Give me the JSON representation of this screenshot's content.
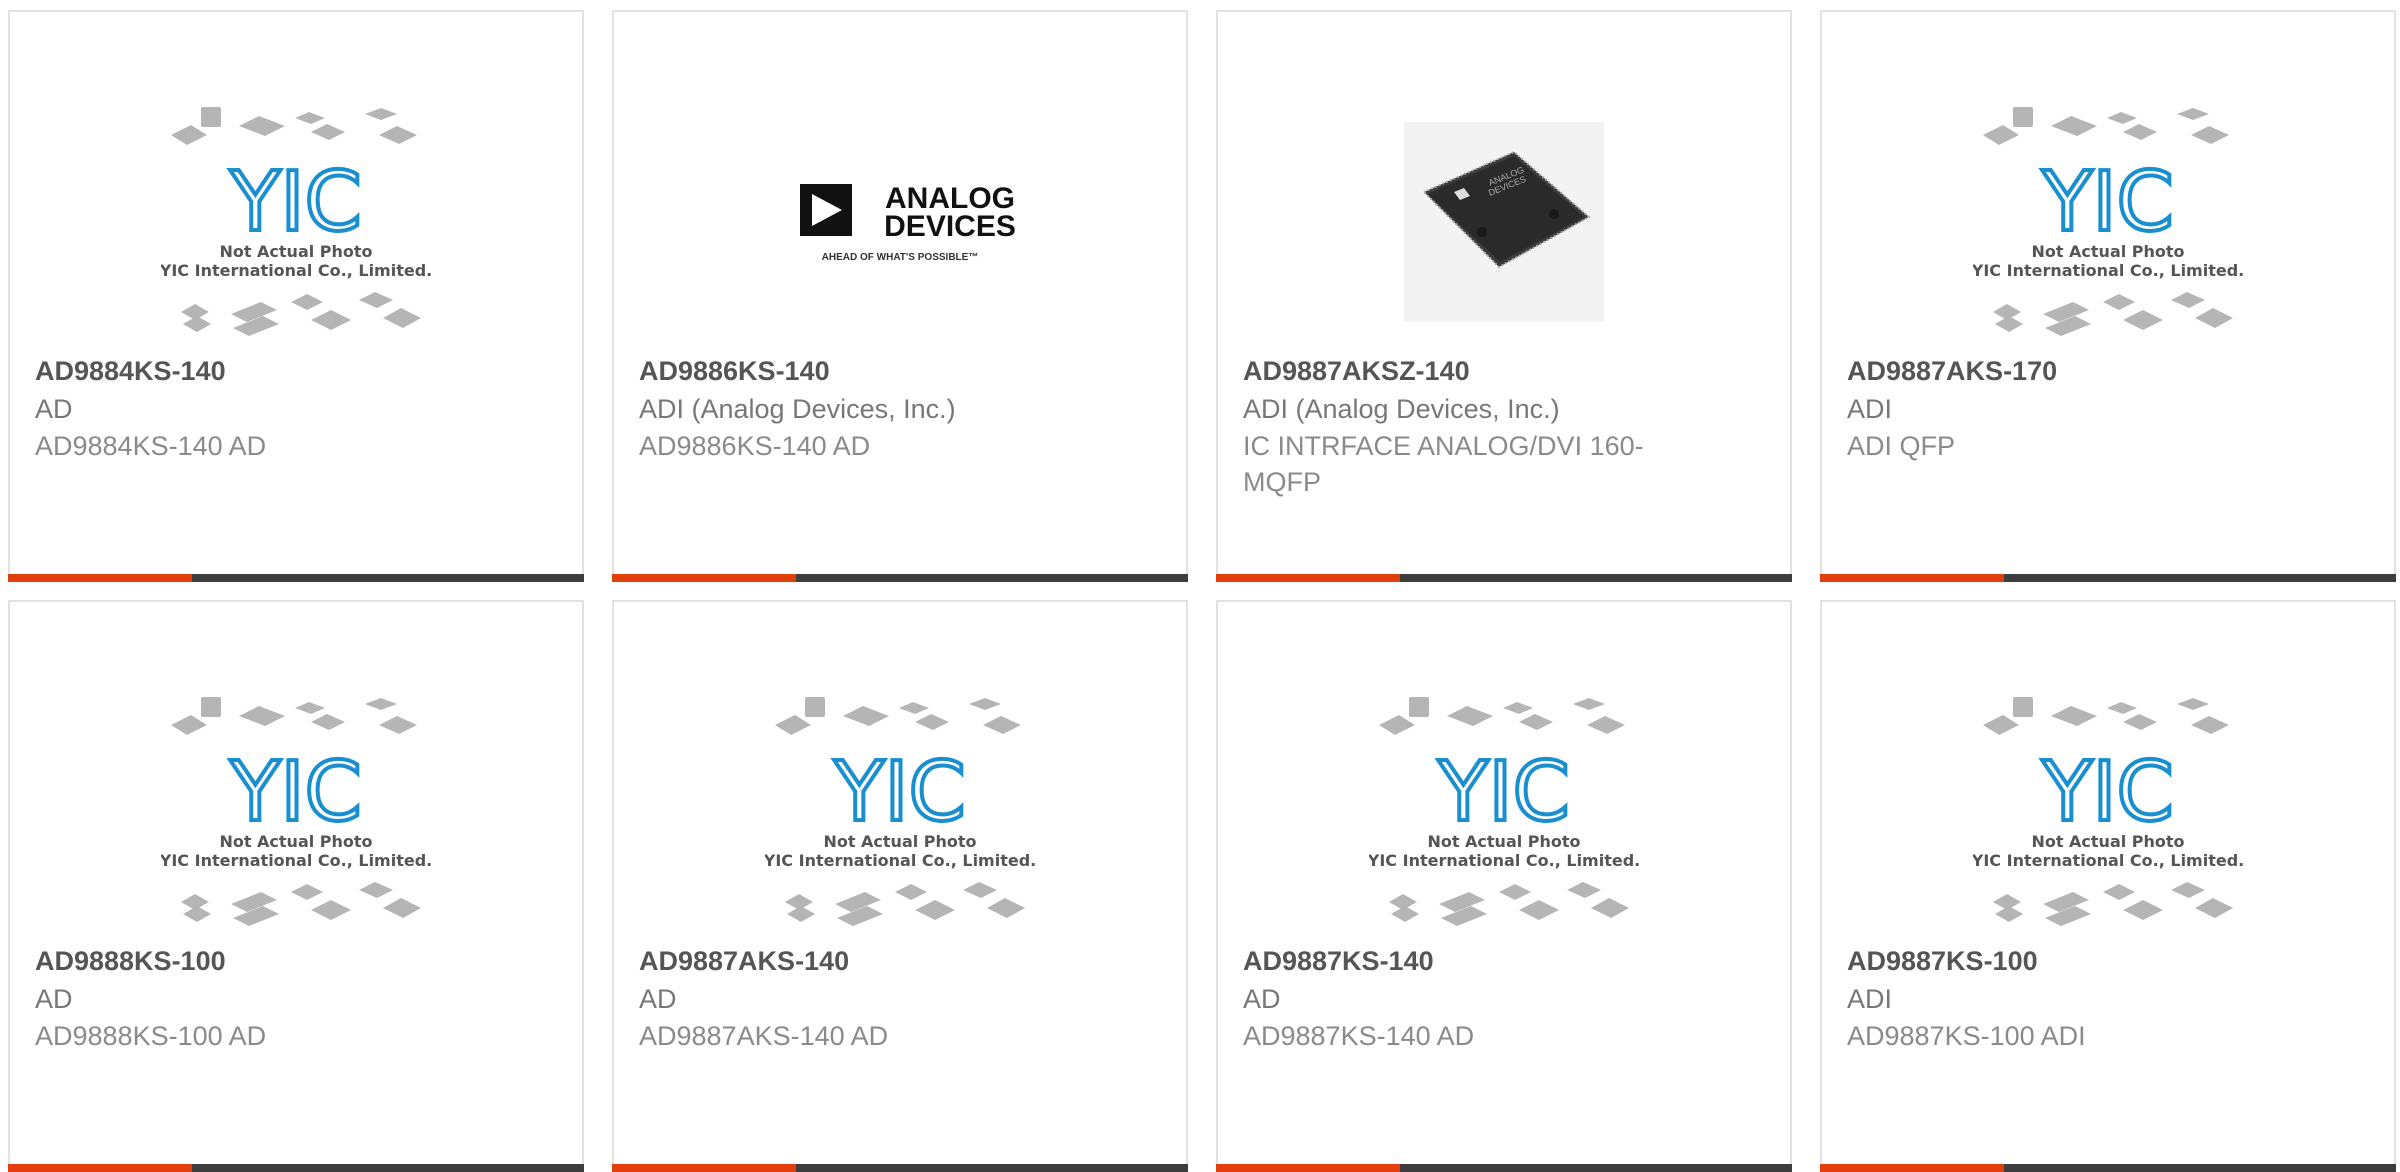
{
  "products": [
    {
      "part_number": "AD9884KS-140",
      "manufacturer": "AD",
      "description": "AD9884KS-140 AD",
      "image": "yic-placeholder"
    },
    {
      "part_number": "AD9886KS-140",
      "manufacturer": "ADI (Analog Devices, Inc.)",
      "description": "AD9886KS-140 AD",
      "image": "analog-devices-logo"
    },
    {
      "part_number": "AD9887AKSZ-140",
      "manufacturer": "ADI (Analog Devices, Inc.)",
      "description": "IC INTRFACE ANALOG/DVI 160-MQFP",
      "image": "qfp-chip-photo"
    },
    {
      "part_number": "AD9887AKS-170",
      "manufacturer": "ADI",
      "description": "ADI QFP",
      "image": "yic-placeholder"
    },
    {
      "part_number": "AD9888KS-100",
      "manufacturer": "AD",
      "description": "AD9888KS-100 AD",
      "image": "yic-placeholder"
    },
    {
      "part_number": "AD9887AKS-140",
      "manufacturer": "AD",
      "description": "AD9887AKS-140 AD",
      "image": "yic-placeholder"
    },
    {
      "part_number": "AD9887KS-140",
      "manufacturer": "AD",
      "description": "AD9887KS-140 AD",
      "image": "yic-placeholder"
    },
    {
      "part_number": "AD9887KS-100",
      "manufacturer": "ADI",
      "description": "AD9887KS-100 ADI",
      "image": "yic-placeholder"
    }
  ],
  "placeholder_text": {
    "logo_text": "YIC",
    "line1": "Not Actual Photo",
    "line2": "YIC International Co., Limited."
  },
  "adi_logo": {
    "line1": "ANALOG",
    "line2": "DEVICES",
    "tagline": "AHEAD OF WHAT'S POSSIBLE™"
  },
  "chip_marking": {
    "line1": "ANALOG",
    "line2": "DEVICES"
  },
  "colors": {
    "accent": "#e43d0e",
    "bar": "#3d3d3d",
    "border": "#e2e2e2",
    "yic_blue": "#1a8fd0"
  }
}
